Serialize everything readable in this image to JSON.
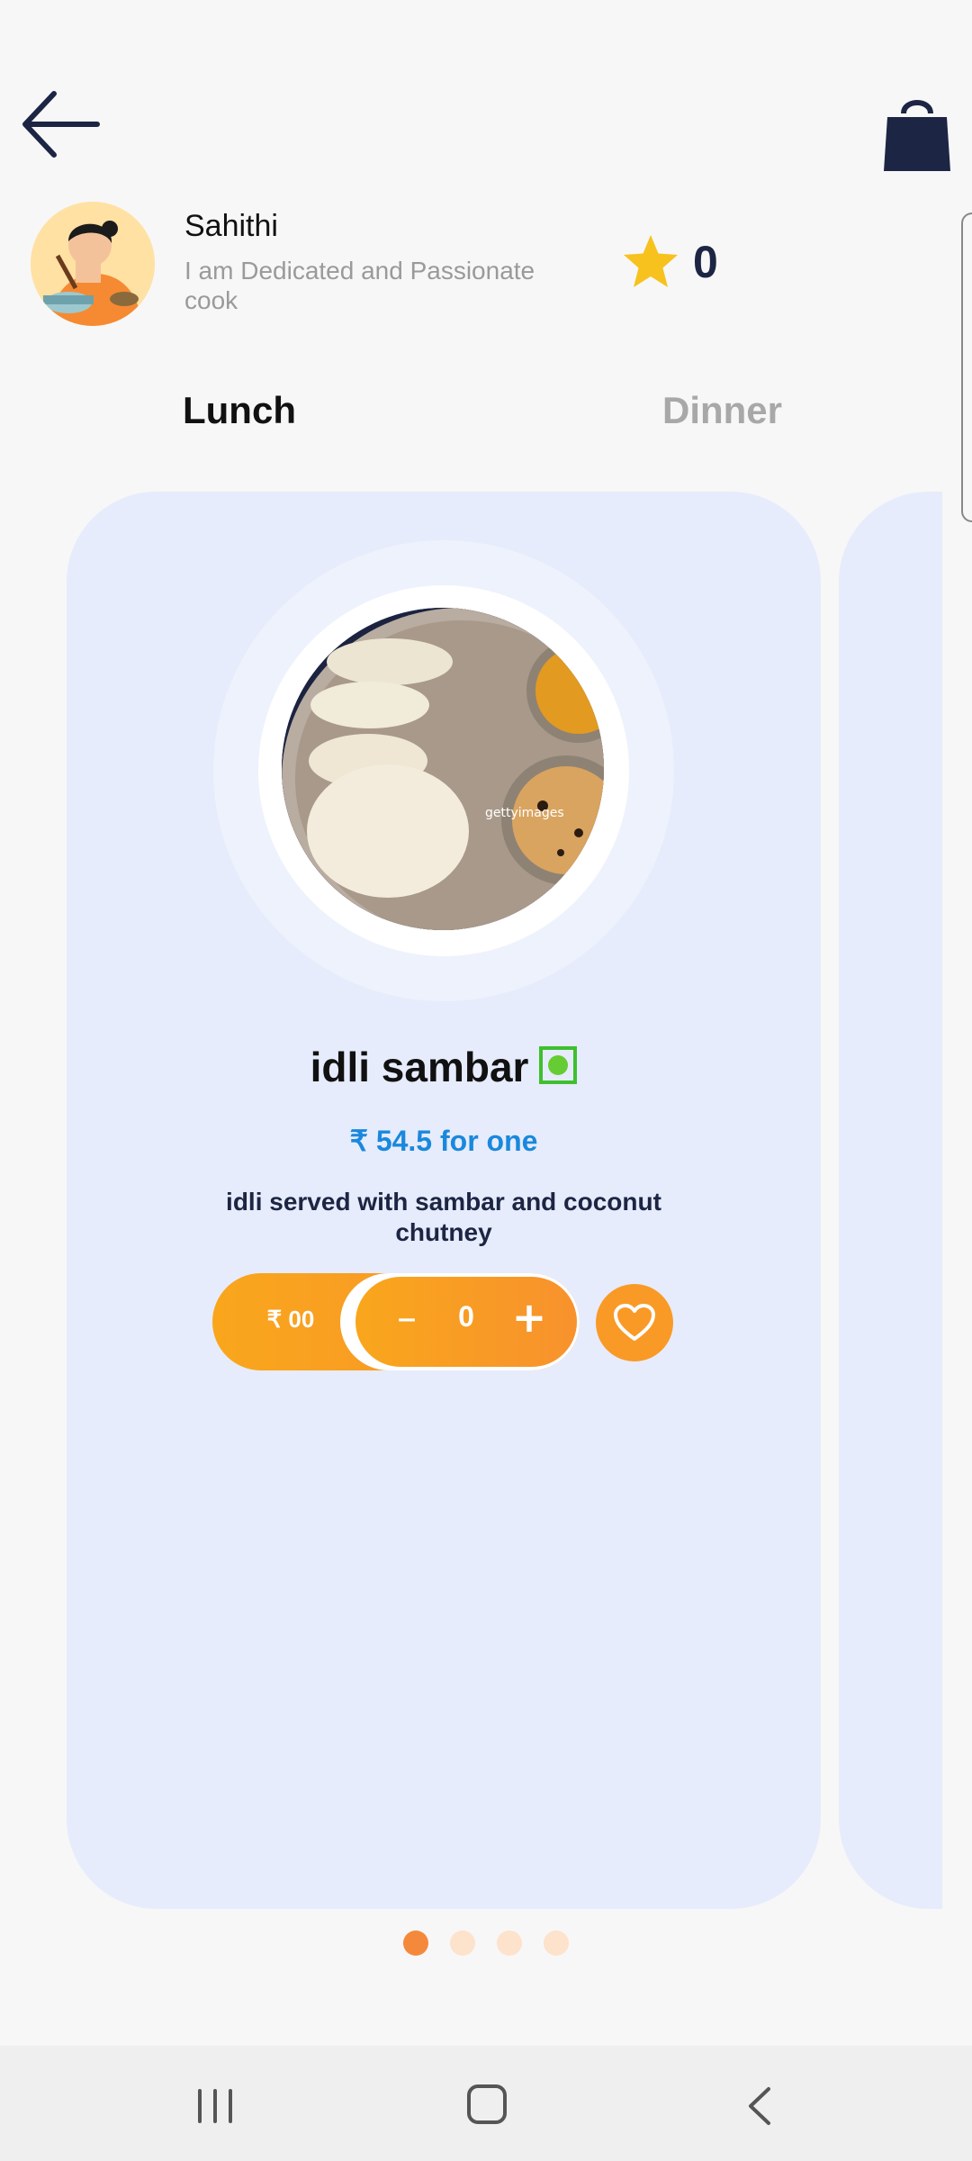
{
  "header": {
    "back_icon": "arrow-left-icon",
    "cart_icon": "shopping-bag-icon",
    "nav_color": "#1c2543"
  },
  "cook": {
    "name": "Sahithi",
    "bio": "I am Dedicated and Passionate cook",
    "rating": "0",
    "rating_icon": "star-icon",
    "star_color": "#f7c21e"
  },
  "tabs": [
    {
      "label": "Lunch",
      "selected": true
    },
    {
      "label": "Dinner",
      "selected": false
    }
  ],
  "dish": {
    "name": "idli sambar",
    "veg_indicator": "veg-mark-icon",
    "price_line": "₹ 54.5 for one",
    "description": "idli served with sambar and coconut chutney",
    "cart_price": "₹ 00",
    "quantity": "0",
    "minus_label": "–",
    "plus_label": "+",
    "favorite_icon": "heart-icon",
    "photo_watermark": "gettyimages"
  },
  "carousel": {
    "total_pages": 4,
    "active_index": 0,
    "active_color": "#f5893b",
    "inactive_color": "#fde2cc"
  },
  "system_nav": {
    "recent_icon": "recent-apps-icon",
    "home_icon": "home-icon",
    "back_icon": "system-back-icon"
  },
  "colors": {
    "accent": "#f8922d",
    "price": "#1a88dd",
    "card_bg": "#e6ecfb",
    "veg_green": "#3fbf2f"
  }
}
